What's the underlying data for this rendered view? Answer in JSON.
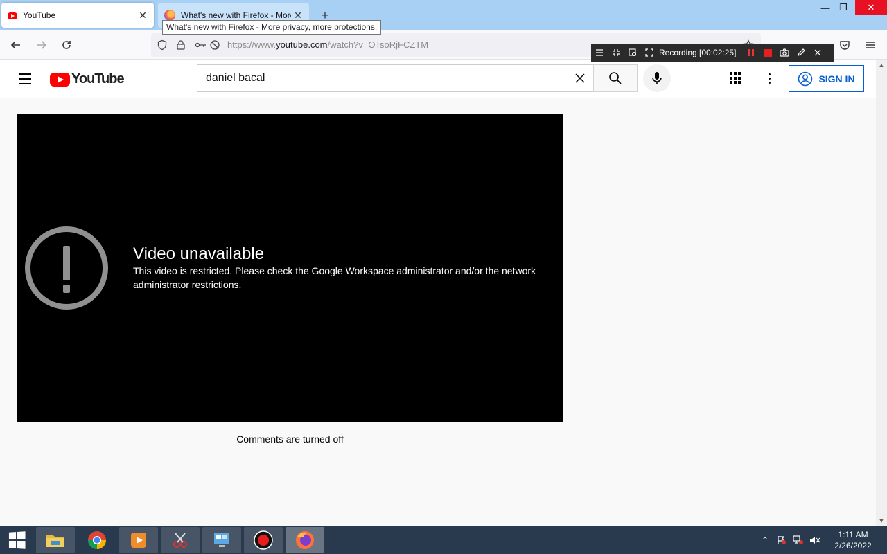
{
  "browser": {
    "tabs": [
      {
        "title": "YouTube",
        "favicon": "youtube-favicon",
        "active": true
      },
      {
        "title": "What's new with Firefox - More",
        "favicon": "firefox-favicon",
        "active": false
      }
    ],
    "tooltip": "What's new with Firefox - More privacy, more protections.",
    "url_prefix": "https://www.",
    "url_domain": "youtube.com",
    "url_path": "/watch?v=OTsoRjFCZTM"
  },
  "recorder": {
    "status": "Recording [00:02:25]",
    "colors": {
      "pause": "#e33333",
      "stop": "#e52020"
    }
  },
  "youtube": {
    "logo_text": "YouTube",
    "search_value": "daniel bacal",
    "sign_in_label": "SIGN IN",
    "player": {
      "error_title": "Video unavailable",
      "error_message": "This video is restricted. Please check the Google Workspace administrator and/or the network administrator restrictions."
    },
    "comments_status": "Comments are turned off",
    "colors": {
      "brand_red": "#ff0000",
      "sign_in_blue": "#065fd4"
    }
  },
  "taskbar": {
    "apps": [
      {
        "name": "file-explorer",
        "state": "pinned"
      },
      {
        "name": "chrome",
        "state": "normal"
      },
      {
        "name": "media-player",
        "state": "pinned"
      },
      {
        "name": "snipping-tool",
        "state": "pinned"
      },
      {
        "name": "control-panel",
        "state": "pinned"
      },
      {
        "name": "screen-recorder",
        "state": "pinned"
      },
      {
        "name": "firefox",
        "state": "active"
      }
    ],
    "time": "1:11 AM",
    "date": "2/26/2022"
  }
}
